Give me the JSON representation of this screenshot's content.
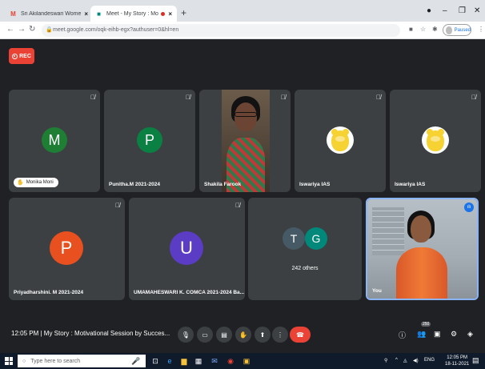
{
  "browser": {
    "tabs": [
      {
        "title": "Sri Akilandeswari Women's Colle",
        "active": false,
        "favicon": "gmail-icon"
      },
      {
        "title": "Meet - My Story : Motivatio",
        "active": true,
        "favicon": "meet-icon"
      }
    ],
    "new_tab": "+",
    "url": "meet.google.com/oqk-eihb-egx?authuser=0&hl=en",
    "profile_status": "Paused"
  },
  "meeting": {
    "rec_label": "REC",
    "participants": [
      {
        "name": "Monika Moni",
        "initial": "M",
        "color": "#1e7e34",
        "hand_raised": true
      },
      {
        "name": "Punitha.M 2021-2024",
        "initial": "P",
        "color": "#0b8043"
      },
      {
        "name": "Shakila Farook",
        "video": true
      },
      {
        "name": "Iswariya IAS",
        "avatar": "teddy-bear"
      },
      {
        "name": "Iswariya IAS",
        "avatar": "teddy-bear"
      },
      {
        "name": "Priyadharshini. M 2021-2024",
        "initial": "P",
        "color": "#e8511f"
      },
      {
        "name": "UMAMAHESWARI K. COMCA 2021-2024 Ba...",
        "initial": "U",
        "color": "#5b3cc4"
      },
      {
        "others_initials": [
          "T",
          "G"
        ],
        "others_colors": [
          "#455a64",
          "#00897b"
        ],
        "others_count_label": "242 others"
      },
      {
        "name": "You",
        "video": true,
        "self": true
      }
    ],
    "time": "12:05 PM",
    "title": "My Story : Motivational Session by Succes...",
    "participant_badge": "250"
  },
  "taskbar": {
    "search_placeholder": "Type here to search",
    "language": "ENG",
    "clock_time": "12:05 PM",
    "clock_date": "18-11-2021"
  }
}
